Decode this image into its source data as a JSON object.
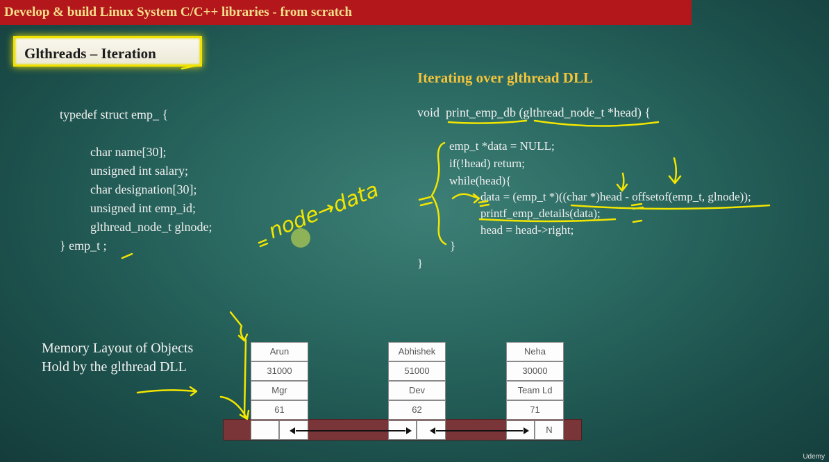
{
  "banner": {
    "text": "Develop & build Linux System C/C++ libraries - from scratch"
  },
  "slide": {
    "title": "Glthreads – Iteration"
  },
  "struct_code": {
    "lines": [
      "typedef struct emp_ {",
      "char name[30];",
      "unsigned int salary;",
      "char designation[30];",
      "unsigned int emp_id;",
      "glthread_node_t glnode;",
      "} emp_t ;"
    ]
  },
  "iter": {
    "title": "Iterating over glthread DLL",
    "lines": [
      "void  print_emp_db (glthread_node_t *head) {",
      "emp_t *data = NULL;",
      "if(!head) return;",
      "while(head){",
      "data = (emp_t *)((char *)head - offsetof(emp_t, glnode));",
      "printf_emp_details(data);",
      "head = head->right;",
      "}",
      "}"
    ]
  },
  "memory": {
    "label_line1": "Memory Layout of Objects",
    "label_line2": "Hold by the glthread DLL",
    "objects": [
      {
        "name": "Arun",
        "salary": "31000",
        "designation": "Mgr",
        "emp_id": "61"
      },
      {
        "name": "Abhishek",
        "salary": "51000",
        "designation": "Dev",
        "emp_id": "62"
      },
      {
        "name": "Neha",
        "salary": "30000",
        "designation": "Team Ld",
        "emp_id": "71"
      }
    ],
    "null_marker": "N"
  },
  "annotation": {
    "handwritten": "node→data"
  },
  "watermark": "Udemy",
  "colors": {
    "banner_bg": "#b3171c",
    "banner_text": "#f7e08a",
    "highlight": "#f2e200",
    "section_title": "#f4c43b",
    "band": "#7a3538"
  }
}
